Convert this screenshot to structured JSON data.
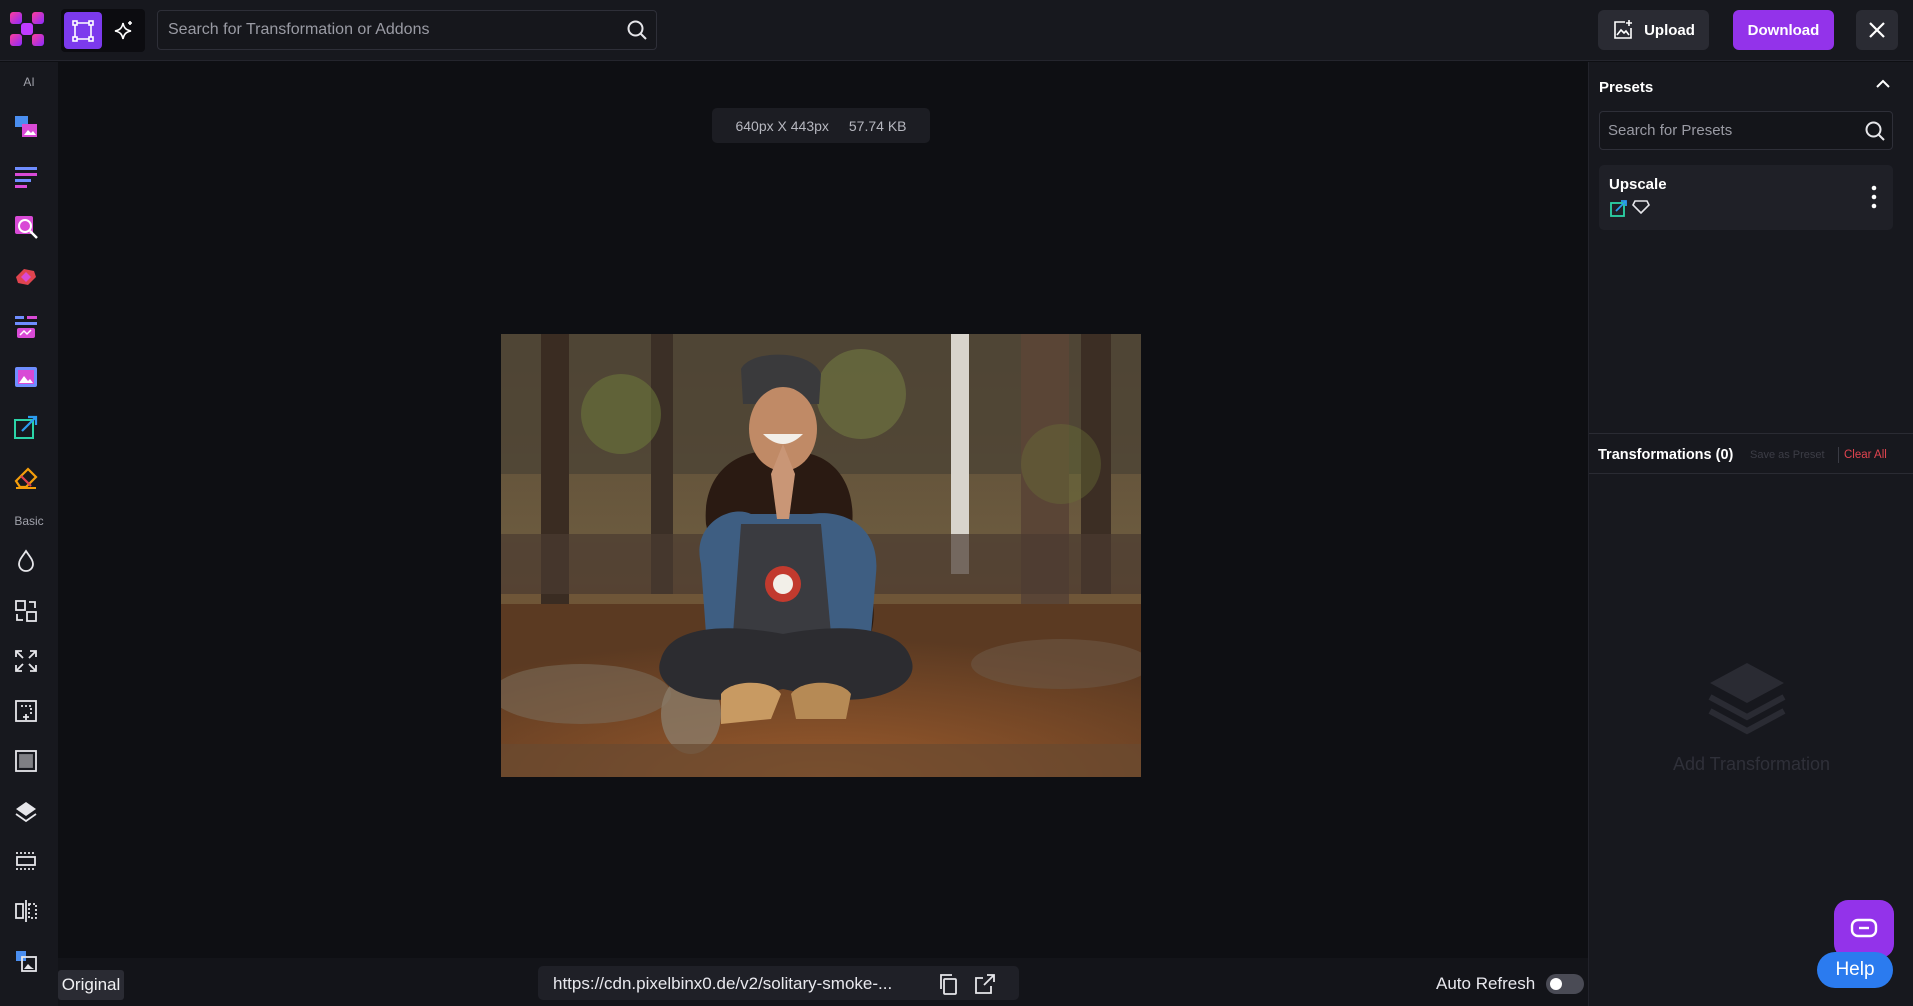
{
  "header": {
    "search_placeholder": "Search for Transformation or Addons",
    "upload_label": "Upload",
    "download_label": "Download"
  },
  "sidebar": {
    "ai_label": "AI",
    "basic_label": "Basic",
    "ai_tools": [
      "image-extend-icon",
      "text-extract-icon",
      "object-search-icon",
      "background-remove-icon",
      "batch-process-icon",
      "watermark-icon",
      "upscale-icon",
      "eraser-icon"
    ],
    "basic_tools": [
      "blur-drop-icon",
      "convert-icon",
      "resize-icon",
      "crop-icon",
      "frame-icon",
      "layers-icon",
      "border-icon",
      "flip-icon",
      "overlay-icon"
    ]
  },
  "canvas": {
    "dimensions": "640px X 443px",
    "file_size": "57.74 KB"
  },
  "bottom": {
    "original_label": "Original",
    "url": "https://cdn.pixelbinx0.de/v2/solitary-smoke-...",
    "auto_refresh_label": "Auto Refresh",
    "auto_refresh_on": false
  },
  "presets": {
    "title": "Presets",
    "search_placeholder": "Search for Presets",
    "items": [
      {
        "name": "Upscale"
      }
    ]
  },
  "transformations": {
    "title": "Transformations (0)",
    "save_as_preset": "Save as Preset",
    "clear_all": "Clear All",
    "empty_text": "Add Transformation"
  },
  "help": {
    "label": "Help"
  },
  "colors": {
    "accent": "#9333ea",
    "danger": "#e0444f",
    "help": "#2b7bef"
  }
}
